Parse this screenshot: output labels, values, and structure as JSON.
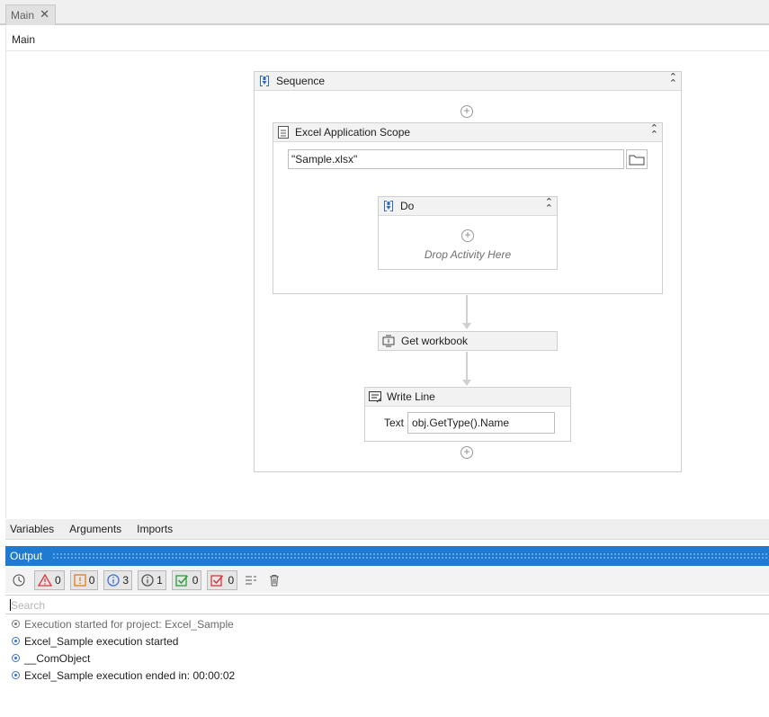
{
  "document_tab": {
    "label": "Main"
  },
  "breadcrumb": {
    "label": "Main"
  },
  "sequence": {
    "title": "Sequence"
  },
  "excel_scope": {
    "title": "Excel Application Scope",
    "workbook_path": "\"Sample.xlsx\""
  },
  "do_block": {
    "title": "Do",
    "drop_hint": "Drop Activity Here"
  },
  "get_workbook": {
    "title": "Get workbook"
  },
  "write_line": {
    "title": "Write Line",
    "text_label": "Text",
    "text_value": "obj.GetType().Name"
  },
  "bottom_tabs": [
    "Variables",
    "Arguments",
    "Imports"
  ],
  "output": {
    "title": "Output",
    "filters": {
      "errors": "0",
      "warnings": "0",
      "info": "3",
      "trace": "1",
      "success": "0",
      "failed": "0"
    },
    "search_placeholder": "Search",
    "log": [
      {
        "text": "Execution started for project: Excel_Sample",
        "level": "trace"
      },
      {
        "text": "Excel_Sample execution started",
        "level": "info"
      },
      {
        "text": "__ComObject",
        "level": "info"
      },
      {
        "text": "Excel_Sample execution ended in: 00:00:02",
        "level": "info"
      }
    ]
  },
  "colors": {
    "output_header": "#1f7bd1",
    "info_dot": "#3b6fd8",
    "error": "#d9363e",
    "warning": "#e07a1f",
    "success": "#2a9d3a"
  }
}
